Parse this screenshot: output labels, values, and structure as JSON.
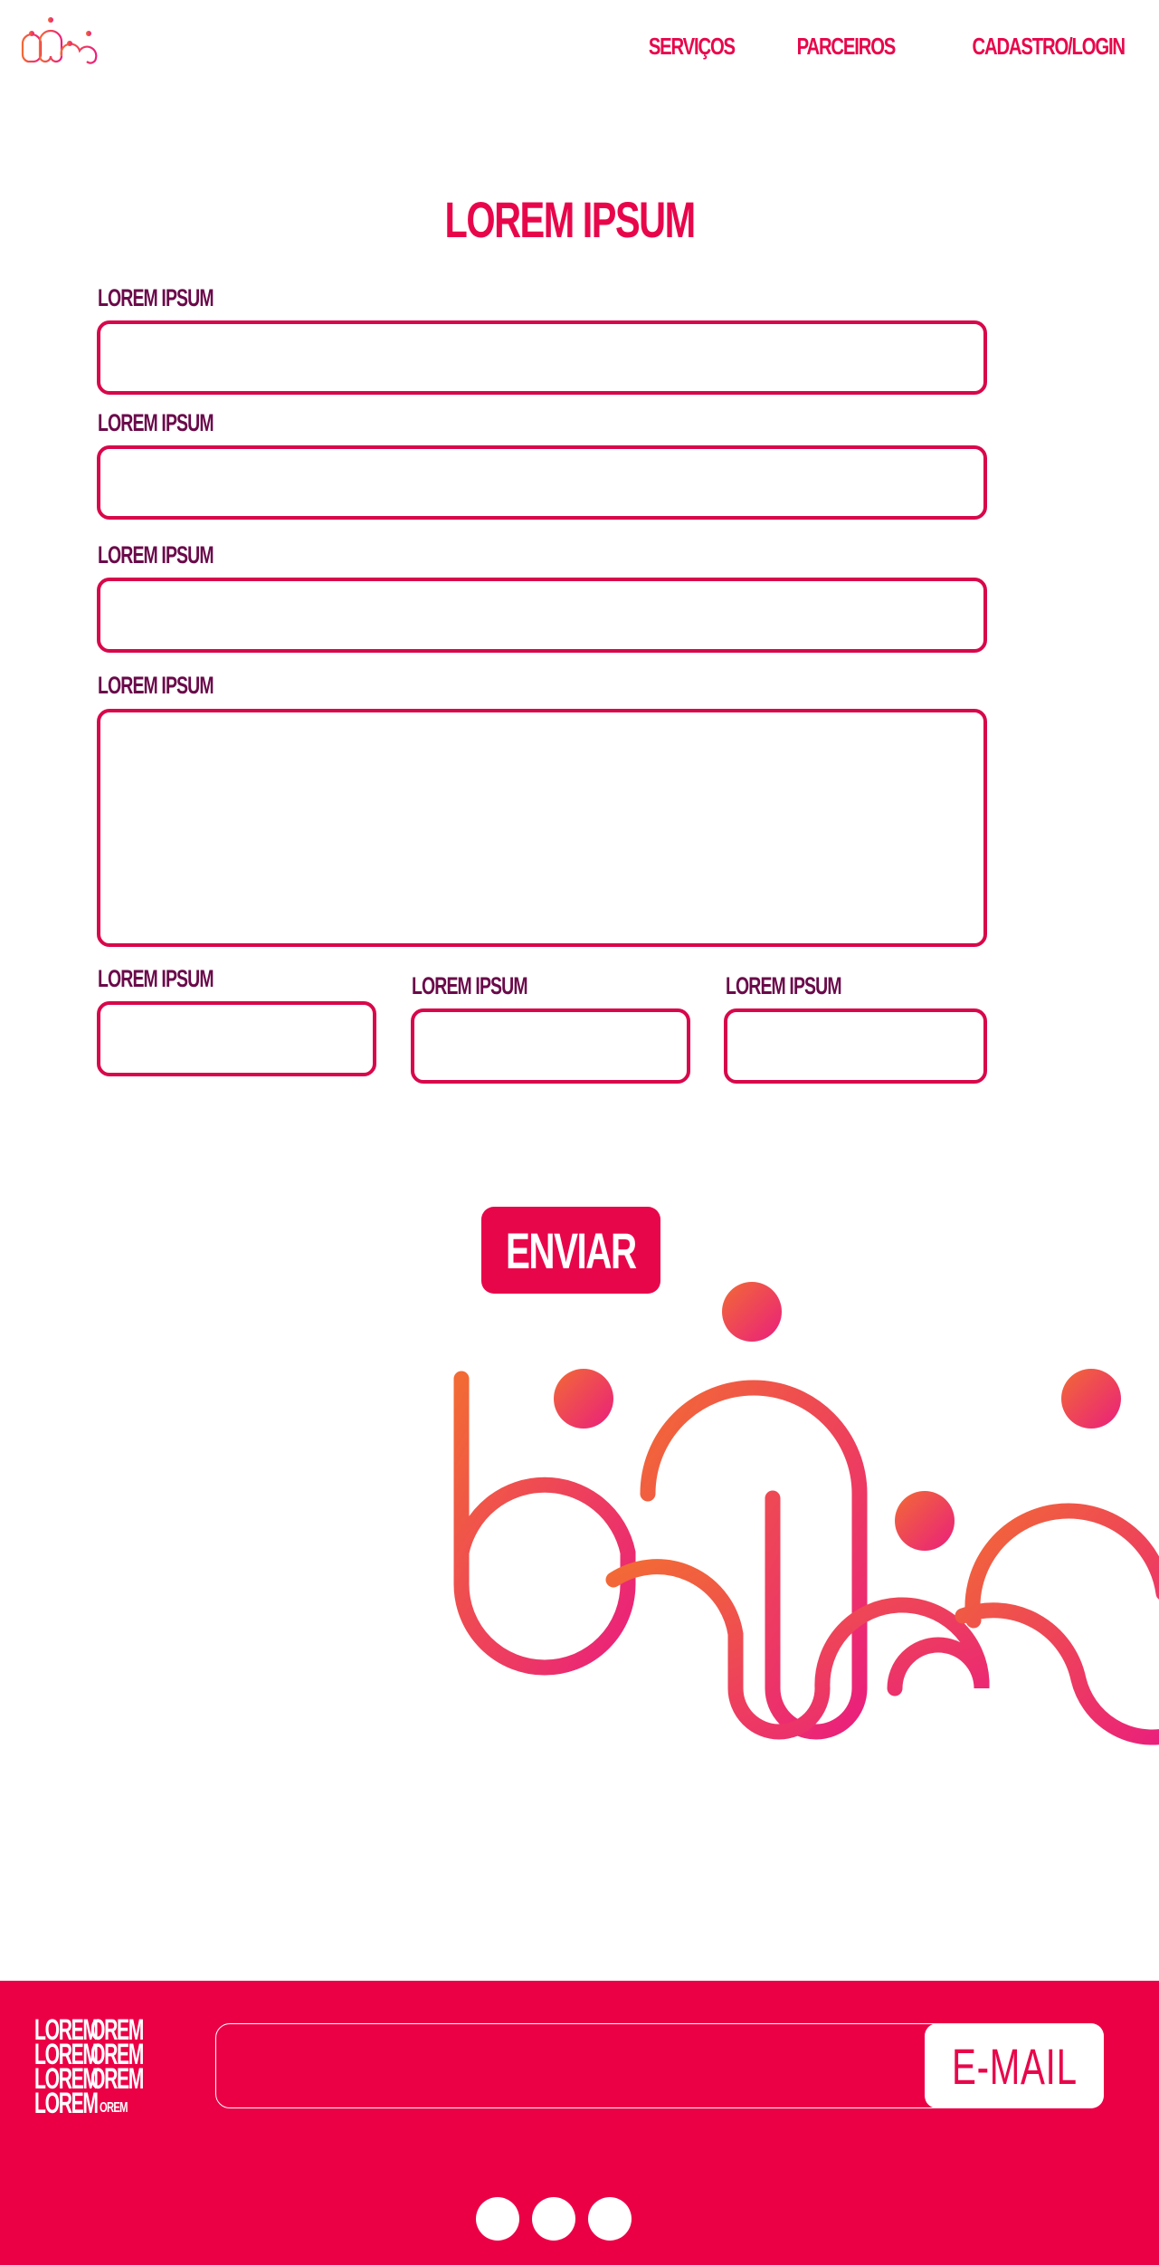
{
  "header": {
    "logo_icon": "people-logo-icon",
    "nav": [
      {
        "label": "SERVIÇOS"
      },
      {
        "label": "PARCEIROS"
      },
      {
        "label": "CADASTRO/LOGIN"
      }
    ]
  },
  "form": {
    "title": "LOREM IPSUM",
    "fields": [
      {
        "label": "LOREM IPSUM",
        "value": ""
      },
      {
        "label": "LOREM IPSUM",
        "value": ""
      },
      {
        "label": "LOREM IPSUM",
        "value": ""
      },
      {
        "label": "LOREM IPSUM",
        "value": ""
      },
      {
        "label": "LOREM IPSUM",
        "value": ""
      },
      {
        "label": "LOREM IPSUM",
        "value": ""
      },
      {
        "label": "LOREM IPSUM",
        "value": ""
      }
    ],
    "submit_label": "ENVIAR"
  },
  "hero": {
    "icon": "people-illustration-icon"
  },
  "footer": {
    "logo_text_large": "LOREM",
    "logo_text_small": "OREM",
    "email_value": "",
    "email_button_label": "E-MAIL",
    "social_icons": [
      "social-icon-1",
      "social-icon-2",
      "social-icon-3"
    ]
  },
  "colors": {
    "brand": "#e8064b",
    "label": "#6a0a4a",
    "footer_bg": "#eb0046",
    "gradient_start": "#f26a35",
    "gradient_end": "#ea1f7c"
  }
}
